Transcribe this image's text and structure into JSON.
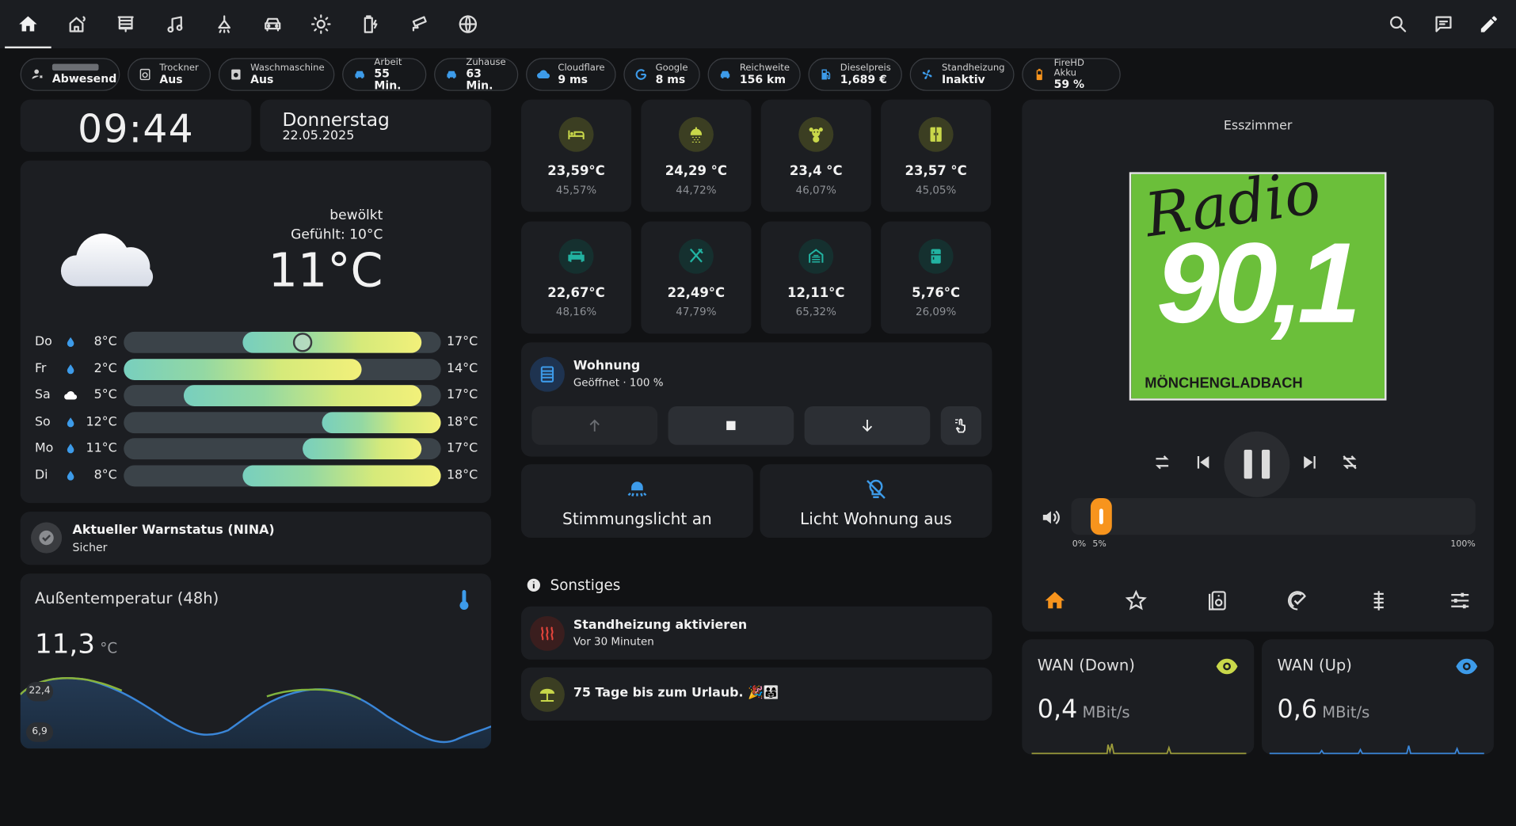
{
  "topbar": {
    "nav_icons": [
      "home-icon",
      "home-sensors-icon",
      "blinds-icon",
      "music-note-icon",
      "ceiling-light-icon",
      "car-icon",
      "sun-icon",
      "battery-charging-icon",
      "cctv-icon",
      "globe-icon"
    ],
    "action_icons": [
      "search-icon",
      "assist-chat-icon",
      "edit-pencil-icon"
    ]
  },
  "chips": [
    {
      "label": "",
      "value": "Abwesend",
      "icon": "person-away-icon",
      "color": "#cfcfcf"
    },
    {
      "label": "Trockner",
      "value": "Aus",
      "icon": "tumble-dryer-icon",
      "color": "#cfcfcf"
    },
    {
      "label": "Waschmaschine",
      "value": "Aus",
      "icon": "washing-machine-icon",
      "color": "#cfcfcf"
    },
    {
      "label": "Arbeit",
      "value": "55 Min.",
      "icon": "car-icon",
      "color": "#3d9be9"
    },
    {
      "label": "Zuhause",
      "value": "63 Min.",
      "icon": "car-icon",
      "color": "#3d9be9"
    },
    {
      "label": "Cloudflare",
      "value": "9 ms",
      "icon": "cloud-icon",
      "color": "#3d9be9"
    },
    {
      "label": "Google",
      "value": "8 ms",
      "icon": "google-icon",
      "color": "#3d9be9"
    },
    {
      "label": "Reichweite",
      "value": "156 km",
      "icon": "car-speed-icon",
      "color": "#3d9be9"
    },
    {
      "label": "Dieselpreis",
      "value": "1,689 €",
      "icon": "gas-station-icon",
      "color": "#3d9be9"
    },
    {
      "label": "Standheizung",
      "value": "Inaktiv",
      "icon": "fan-icon",
      "color": "#3d9be9"
    },
    {
      "label": "FireHD Akku",
      "value": "59 %",
      "icon": "battery-icon",
      "color": "#f7941d"
    }
  ],
  "clock": {
    "time": "09:44"
  },
  "date": {
    "weekday": "Donnerstag",
    "date": "22.05.2025"
  },
  "weather": {
    "condition": "bewölkt",
    "feels_like": "Gefühlt: 10°C",
    "temperature": "11°C",
    "current_marker": 11,
    "scale_min": 2,
    "scale_max": 18,
    "forecast": [
      {
        "day": "Do",
        "icon": "raindrop-icon",
        "low": "8°C",
        "high": "17°C",
        "low_v": 8,
        "high_v": 17
      },
      {
        "day": "Fr",
        "icon": "raindrop-icon",
        "low": "2°C",
        "high": "14°C",
        "low_v": 2,
        "high_v": 14
      },
      {
        "day": "Sa",
        "icon": "cloud-icon",
        "low": "5°C",
        "high": "17°C",
        "low_v": 5,
        "high_v": 17
      },
      {
        "day": "So",
        "icon": "raindrop-icon",
        "low": "12°C",
        "high": "18°C",
        "low_v": 12,
        "high_v": 18
      },
      {
        "day": "Mo",
        "icon": "raindrop-icon",
        "low": "11°C",
        "high": "17°C",
        "low_v": 11,
        "high_v": 17
      },
      {
        "day": "Di",
        "icon": "raindrop-icon",
        "low": "8°C",
        "high": "18°C",
        "low_v": 8,
        "high_v": 18
      }
    ]
  },
  "warning": {
    "title": "Aktueller Warnstatus (NINA)",
    "status": "Sicher"
  },
  "outdoor": {
    "title": "Außentemperatur (48h)",
    "value": "11,3",
    "unit": "°C",
    "max_label": "22,4",
    "min_label": "6,9"
  },
  "sensors": [
    {
      "icon": "bed-icon",
      "temp": "23,59°C",
      "humidity": "45,57%",
      "color": "#c9d84a",
      "bg": "#3b3e22"
    },
    {
      "icon": "shower-icon",
      "temp": "24,29 °C",
      "humidity": "44,72%",
      "color": "#c9d84a",
      "bg": "#3b3e22"
    },
    {
      "icon": "teddy-bear-icon",
      "temp": "23,4 °C",
      "humidity": "46,07%",
      "color": "#c9d84a",
      "bg": "#3b3e22"
    },
    {
      "icon": "wardrobe-icon",
      "temp": "23,57 °C",
      "humidity": "45,05%",
      "color": "#c9d84a",
      "bg": "#3b3e22"
    },
    {
      "icon": "sofa-icon",
      "temp": "22,67°C",
      "humidity": "48,16%",
      "color": "#22b3a2",
      "bg": "#15302f"
    },
    {
      "icon": "silverware-icon",
      "temp": "22,49°C",
      "humidity": "47,79%",
      "color": "#22b3a2",
      "bg": "#15302f"
    },
    {
      "icon": "garage-icon",
      "temp": "12,11°C",
      "humidity": "65,32%",
      "color": "#22b3a2",
      "bg": "#15302f"
    },
    {
      "icon": "fridge-icon",
      "temp": "5,76°C",
      "humidity": "26,09%",
      "color": "#22b3a2",
      "bg": "#15302f"
    }
  ],
  "cover": {
    "title": "Wohnung",
    "state": "Geöffnet · 100 %",
    "icon": "window-shutter-icon"
  },
  "scenes": [
    {
      "label": "Stimmungslicht an",
      "icon": "ceiling-fan-light-icon",
      "color": "#3d9be9"
    },
    {
      "label": "Licht Wohnung aus",
      "icon": "lightbulb-off-icon",
      "color": "#3d9be9"
    }
  ],
  "misc": {
    "title": "Sonstiges",
    "items": [
      {
        "title": "Standheizung aktivieren",
        "sub": "Vor 30 Minuten",
        "icon": "radiator-icon"
      },
      {
        "title": "75 Tage bis zum Urlaub. 🎉👨‍👩‍👧",
        "sub": "",
        "icon": "beach-icon"
      }
    ]
  },
  "media": {
    "room": "Esszimmer",
    "art_text_top": "Radio",
    "art_text_big": "90,1",
    "art_text_city": "MÖNCHENGLADBACH",
    "art_bg": "#6bbf3a",
    "volume_percent": 5,
    "vol_min": "0%",
    "vol_cur": "5%",
    "vol_max": "100%",
    "accent": "#f7941d",
    "tabs": [
      "home-icon",
      "star-icon",
      "speaker-icon",
      "playlist-check-icon",
      "equalizer-icon",
      "tune-icon"
    ]
  },
  "wan": [
    {
      "title": "WAN (Down)",
      "value": "0,4",
      "unit": "MBit/s",
      "icon": "eye-icon",
      "color": "#c9d84a"
    },
    {
      "title": "WAN (Up)",
      "value": "0,6",
      "unit": "MBit/s",
      "icon": "eye-icon",
      "color": "#3d9be9"
    }
  ]
}
